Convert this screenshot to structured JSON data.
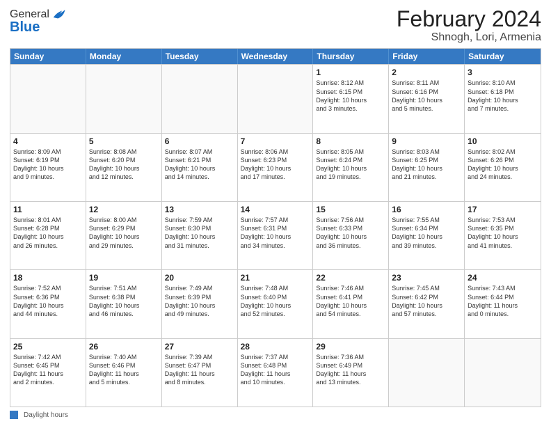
{
  "header": {
    "logo_general": "General",
    "logo_blue": "Blue",
    "main_title": "February 2024",
    "subtitle": "Shnogh, Lori, Armenia"
  },
  "calendar": {
    "days_of_week": [
      "Sunday",
      "Monday",
      "Tuesday",
      "Wednesday",
      "Thursday",
      "Friday",
      "Saturday"
    ],
    "rows": [
      [
        {
          "day": "",
          "info": ""
        },
        {
          "day": "",
          "info": ""
        },
        {
          "day": "",
          "info": ""
        },
        {
          "day": "",
          "info": ""
        },
        {
          "day": "1",
          "info": "Sunrise: 8:12 AM\nSunset: 6:15 PM\nDaylight: 10 hours\nand 3 minutes."
        },
        {
          "day": "2",
          "info": "Sunrise: 8:11 AM\nSunset: 6:16 PM\nDaylight: 10 hours\nand 5 minutes."
        },
        {
          "day": "3",
          "info": "Sunrise: 8:10 AM\nSunset: 6:18 PM\nDaylight: 10 hours\nand 7 minutes."
        }
      ],
      [
        {
          "day": "4",
          "info": "Sunrise: 8:09 AM\nSunset: 6:19 PM\nDaylight: 10 hours\nand 9 minutes."
        },
        {
          "day": "5",
          "info": "Sunrise: 8:08 AM\nSunset: 6:20 PM\nDaylight: 10 hours\nand 12 minutes."
        },
        {
          "day": "6",
          "info": "Sunrise: 8:07 AM\nSunset: 6:21 PM\nDaylight: 10 hours\nand 14 minutes."
        },
        {
          "day": "7",
          "info": "Sunrise: 8:06 AM\nSunset: 6:23 PM\nDaylight: 10 hours\nand 17 minutes."
        },
        {
          "day": "8",
          "info": "Sunrise: 8:05 AM\nSunset: 6:24 PM\nDaylight: 10 hours\nand 19 minutes."
        },
        {
          "day": "9",
          "info": "Sunrise: 8:03 AM\nSunset: 6:25 PM\nDaylight: 10 hours\nand 21 minutes."
        },
        {
          "day": "10",
          "info": "Sunrise: 8:02 AM\nSunset: 6:26 PM\nDaylight: 10 hours\nand 24 minutes."
        }
      ],
      [
        {
          "day": "11",
          "info": "Sunrise: 8:01 AM\nSunset: 6:28 PM\nDaylight: 10 hours\nand 26 minutes."
        },
        {
          "day": "12",
          "info": "Sunrise: 8:00 AM\nSunset: 6:29 PM\nDaylight: 10 hours\nand 29 minutes."
        },
        {
          "day": "13",
          "info": "Sunrise: 7:59 AM\nSunset: 6:30 PM\nDaylight: 10 hours\nand 31 minutes."
        },
        {
          "day": "14",
          "info": "Sunrise: 7:57 AM\nSunset: 6:31 PM\nDaylight: 10 hours\nand 34 minutes."
        },
        {
          "day": "15",
          "info": "Sunrise: 7:56 AM\nSunset: 6:33 PM\nDaylight: 10 hours\nand 36 minutes."
        },
        {
          "day": "16",
          "info": "Sunrise: 7:55 AM\nSunset: 6:34 PM\nDaylight: 10 hours\nand 39 minutes."
        },
        {
          "day": "17",
          "info": "Sunrise: 7:53 AM\nSunset: 6:35 PM\nDaylight: 10 hours\nand 41 minutes."
        }
      ],
      [
        {
          "day": "18",
          "info": "Sunrise: 7:52 AM\nSunset: 6:36 PM\nDaylight: 10 hours\nand 44 minutes."
        },
        {
          "day": "19",
          "info": "Sunrise: 7:51 AM\nSunset: 6:38 PM\nDaylight: 10 hours\nand 46 minutes."
        },
        {
          "day": "20",
          "info": "Sunrise: 7:49 AM\nSunset: 6:39 PM\nDaylight: 10 hours\nand 49 minutes."
        },
        {
          "day": "21",
          "info": "Sunrise: 7:48 AM\nSunset: 6:40 PM\nDaylight: 10 hours\nand 52 minutes."
        },
        {
          "day": "22",
          "info": "Sunrise: 7:46 AM\nSunset: 6:41 PM\nDaylight: 10 hours\nand 54 minutes."
        },
        {
          "day": "23",
          "info": "Sunrise: 7:45 AM\nSunset: 6:42 PM\nDaylight: 10 hours\nand 57 minutes."
        },
        {
          "day": "24",
          "info": "Sunrise: 7:43 AM\nSunset: 6:44 PM\nDaylight: 11 hours\nand 0 minutes."
        }
      ],
      [
        {
          "day": "25",
          "info": "Sunrise: 7:42 AM\nSunset: 6:45 PM\nDaylight: 11 hours\nand 2 minutes."
        },
        {
          "day": "26",
          "info": "Sunrise: 7:40 AM\nSunset: 6:46 PM\nDaylight: 11 hours\nand 5 minutes."
        },
        {
          "day": "27",
          "info": "Sunrise: 7:39 AM\nSunset: 6:47 PM\nDaylight: 11 hours\nand 8 minutes."
        },
        {
          "day": "28",
          "info": "Sunrise: 7:37 AM\nSunset: 6:48 PM\nDaylight: 11 hours\nand 10 minutes."
        },
        {
          "day": "29",
          "info": "Sunrise: 7:36 AM\nSunset: 6:49 PM\nDaylight: 11 hours\nand 13 minutes."
        },
        {
          "day": "",
          "info": ""
        },
        {
          "day": "",
          "info": ""
        }
      ]
    ]
  },
  "legend": {
    "label": "Daylight hours"
  }
}
